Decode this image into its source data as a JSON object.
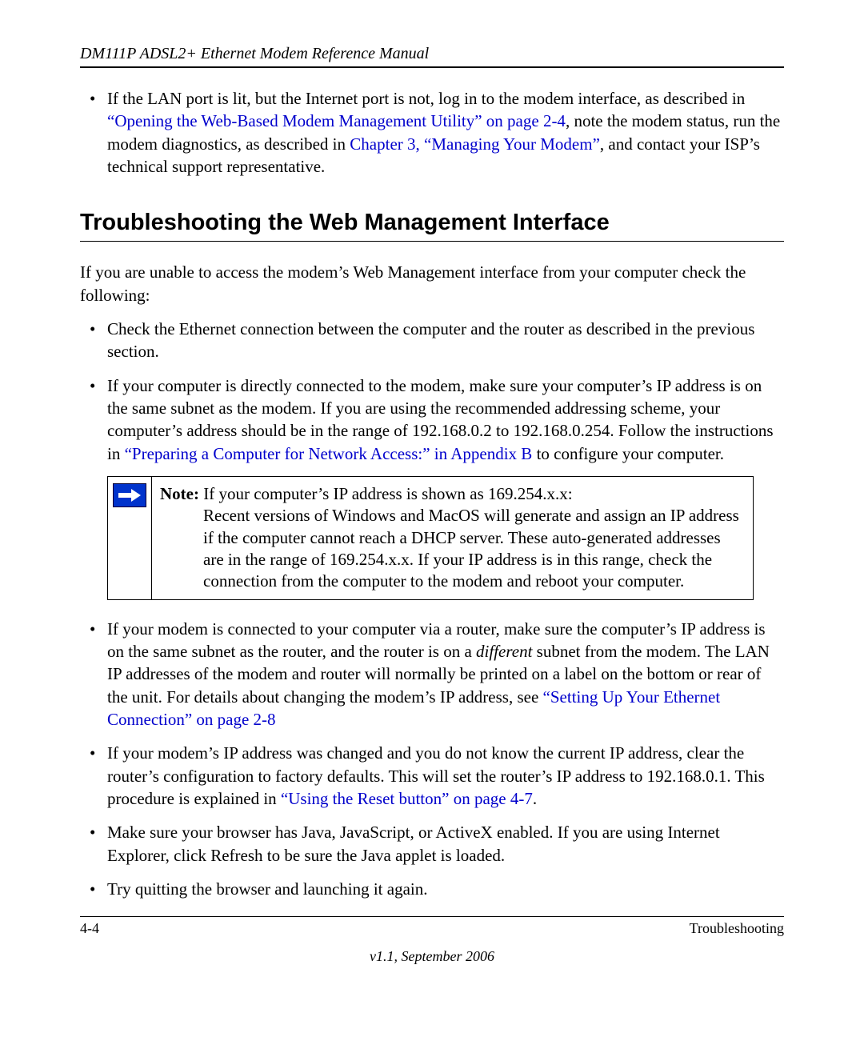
{
  "header": {
    "running_head": "DM111P ADSL2+ Ethernet Modem Reference Manual"
  },
  "top_bullet": {
    "pre": "If the LAN port is lit, but the Internet port is not, log in to the modem interface, as described in ",
    "link1": "“Opening the Web-Based Modem Management Utility” on page 2-4",
    "mid": ", note the modem status, run the modem diagnostics, as described in ",
    "link2": "Chapter 3, “Managing Your Modem”",
    "post": ", and contact your ISP’s technical support representative."
  },
  "section": {
    "title": "Troubleshooting the Web Management Interface",
    "intro": "If you are unable to access the modem’s Web Management interface from your computer check the following:"
  },
  "bullets1": {
    "b1": "Check the Ethernet connection between the computer and the router as described in the previous section.",
    "b2_pre": "If your computer is directly connected to the modem, make sure your computer’s IP address is on the same subnet as the modem. If you are using the recommended addressing scheme, your computer’s address should be in the range of 192.168.0.2 to 192.168.0.254. Follow the instructions in ",
    "b2_link": "“Preparing a Computer for Network Access:” in Appendix B",
    "b2_post": " to configure your computer."
  },
  "note": {
    "label": "Note:",
    "headline": " If your computer’s IP address is shown as 169.254.x.x:",
    "body": "Recent versions of Windows and MacOS will generate and assign an IP address if the computer cannot reach a DHCP server. These auto-generated addresses are in the range of 169.254.x.x. If your IP address is in this range, check the connection from the computer to the modem and reboot your computer."
  },
  "bullets2": {
    "b3_pre": "If your modem is connected to your computer via a router, make sure the computer’s IP address is on the same subnet as the router, and the router is on a ",
    "b3_em": "different",
    "b3_mid": " subnet from the modem. The LAN IP addresses of the modem and router will normally be printed on a label on the bottom or rear of the unit. For details about changing the modem’s IP address, see ",
    "b3_link": "“Setting Up Your Ethernet Connection” on page 2-8",
    "b4_pre": "If your modem’s IP address was changed and you do not know the current IP address, clear the router’s configuration to factory defaults. This will set the router’s IP address to 192.168.0.1. This procedure is explained in ",
    "b4_link": "“Using the Reset button” on page 4-7",
    "b4_post": ".",
    "b5": "Make sure your browser has Java, JavaScript, or ActiveX enabled. If you are using Internet Explorer, click Refresh to be sure the Java applet is loaded.",
    "b6": "Try quitting the browser and launching it again."
  },
  "footer": {
    "page_num": "4-4",
    "section": "Troubleshooting",
    "version": "v1.1, September 2006"
  }
}
